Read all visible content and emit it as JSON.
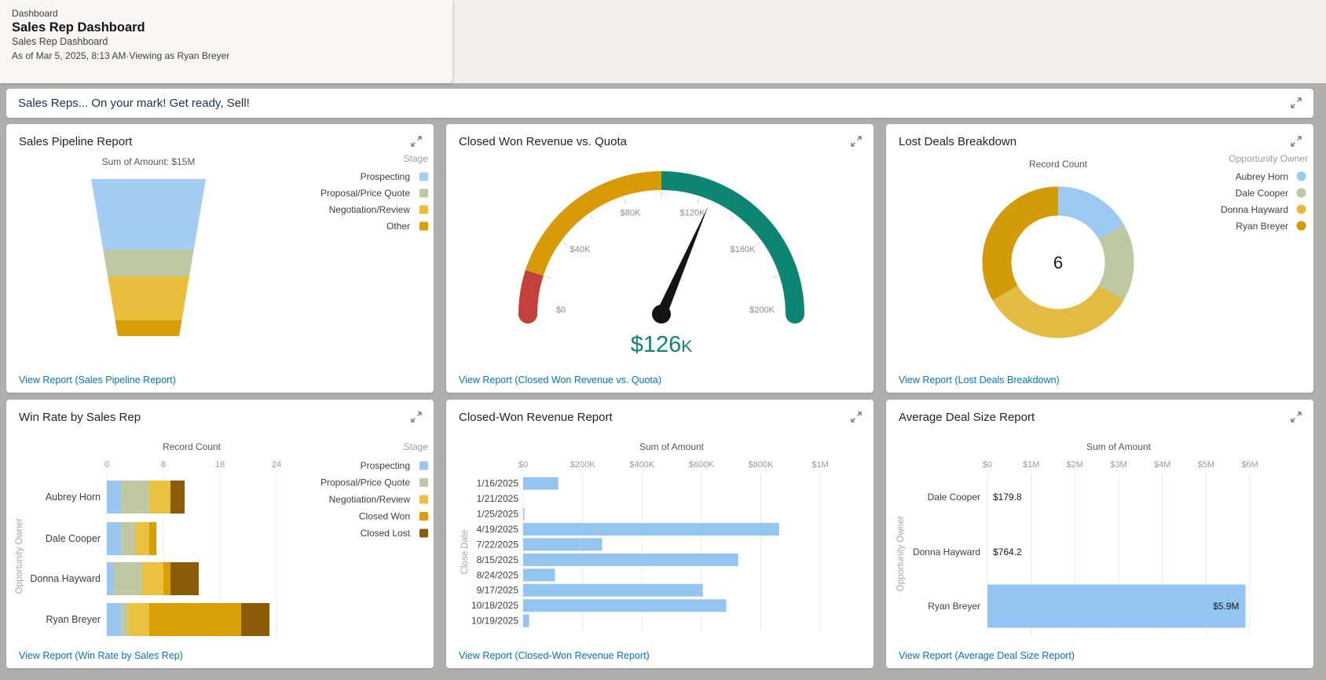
{
  "header": {
    "breadcrumb": "Dashboard",
    "title": "Sales Rep Dashboard",
    "subtitle": "Sales Rep Dashboard",
    "as_of": "As of Mar 5, 2025, 8:13 AM·Viewing as Ryan Breyer"
  },
  "banner": {
    "message": "Sales Reps... On your mark! Get ready, Sell!"
  },
  "colors": {
    "link": "#0176d3",
    "banner_text": "#16325c",
    "prospecting": "#9ac6f0",
    "proposal": "#bfc8a3",
    "negotiation": "#ebc23f",
    "closed_won": "#d9a006",
    "closed_lost": "#8a5c08",
    "gauge_red": "#c3413a",
    "gauge_orange": "#d89b06",
    "gauge_teal": "#0c8572",
    "bar_blue": "#94c5f0"
  },
  "panels": [
    {
      "title": "Sales Pipeline Report",
      "link": "View Report (Sales Pipeline Report)"
    },
    {
      "title": "Closed Won Revenue vs. Quota",
      "link": "View Report (Closed Won Revenue vs. Quota)"
    },
    {
      "title": "Lost Deals Breakdown",
      "link": "View Report (Lost Deals Breakdown)"
    },
    {
      "title": "Win Rate by Sales Rep",
      "link": "View Report (Win Rate by Sales Rep)"
    },
    {
      "title": "Closed-Won Revenue Report",
      "link": "View Report (Closed-Won Revenue Report)"
    },
    {
      "title": "Average Deal Size Report",
      "link": "View Report (Average Deal Size Report)"
    }
  ],
  "chart_data": [
    {
      "type": "funnel",
      "panel": "Sales Pipeline Report",
      "title": "Sum of Amount: $15M",
      "legend_title": "Stage",
      "categories": [
        "Prospecting",
        "Proposal/Price Quote",
        "Negotiation/Review",
        "Other"
      ],
      "percents": [
        45,
        17,
        28,
        10
      ],
      "colors": [
        "#a3cdf3",
        "#bfc8a3",
        "#e9be3d",
        "#d89e07"
      ]
    },
    {
      "type": "gauge",
      "panel": "Closed Won Revenue vs. Quota",
      "min": 0,
      "max": 200000,
      "value": 126000,
      "display_value": "$126",
      "display_suffix": "K",
      "tick_labels": [
        "$0",
        "$40K",
        "$80K",
        "$120K",
        "$160K",
        "$200K"
      ],
      "bands": [
        {
          "from": 0,
          "to": 20000,
          "color": "#c3413a"
        },
        {
          "from": 20000,
          "to": 100000,
          "color": "#d89b06"
        },
        {
          "from": 100000,
          "to": 200000,
          "color": "#0c8572"
        }
      ],
      "value_color": "#0d8473"
    },
    {
      "type": "donut",
      "panel": "Lost Deals Breakdown",
      "title": "Record Count",
      "center_value": "6",
      "legend_title": "Opportunity Owner",
      "segments": [
        {
          "label": "Aubrey Horn",
          "value": 1,
          "color": "#9cc9f2"
        },
        {
          "label": "Dale Cooper",
          "value": 1,
          "color": "#bec7a1"
        },
        {
          "label": "Donna Hayward",
          "value": 2,
          "color": "#e3bb42"
        },
        {
          "label": "Ryan Breyer",
          "value": 2,
          "color": "#d49b08"
        }
      ]
    },
    {
      "type": "stacked_bar",
      "panel": "Win Rate by Sales Rep",
      "title": "Record Count",
      "ylabel": "Opportunity Owner",
      "legend_title": "Stage",
      "x_ticks": [
        0,
        8,
        16,
        24
      ],
      "x_max": 24,
      "categories": [
        "Aubrey Horn",
        "Dale Cooper",
        "Donna Hayward",
        "Ryan Breyer"
      ],
      "series": [
        {
          "name": "Prospecting",
          "color": "#9ac6f0",
          "values": [
            2,
            2,
            1,
            2
          ]
        },
        {
          "name": "Proposal/Price Quote",
          "color": "#bfc8a3",
          "values": [
            4,
            2,
            4,
            1
          ]
        },
        {
          "name": "Negotiation/Review",
          "color": "#ebc23f",
          "values": [
            3,
            2,
            3,
            3
          ]
        },
        {
          "name": "Closed Won",
          "color": "#d9a006",
          "values": [
            0,
            1,
            1,
            13
          ]
        },
        {
          "name": "Closed Lost",
          "color": "#8a5c08",
          "values": [
            2,
            0,
            4,
            4
          ]
        }
      ]
    },
    {
      "type": "bar",
      "panel": "Closed-Won Revenue Report",
      "title": "Sum of Amount",
      "ylabel": "Close Date",
      "x_ticks": [
        "$0",
        "$200K",
        "$400K",
        "$600K",
        "$800K",
        "$1M"
      ],
      "x_max": 1000000,
      "bar_color": "#94c5f0",
      "categories": [
        "1/16/2025",
        "1/21/2025",
        "1/25/2025",
        "4/19/2025",
        "7/22/2025",
        "8/15/2025",
        "8/24/2025",
        "9/17/2025",
        "10/18/2025",
        "10/19/2025"
      ],
      "values": [
        118000,
        1000,
        4000,
        862000,
        266000,
        724000,
        107000,
        605000,
        684000,
        20000
      ]
    },
    {
      "type": "bar",
      "panel": "Average Deal Size Report",
      "title": "Sum of Amount",
      "ylabel": "Opportunity Owner",
      "x_ticks": [
        "$0",
        "$1M",
        "$2M",
        "$3M",
        "$4M",
        "$5M",
        "$6M"
      ],
      "x_max": 6000000,
      "bar_color": "#94c5f0",
      "categories": [
        "Dale Cooper",
        "Donna Hayward",
        "Ryan Breyer"
      ],
      "values": [
        179.8,
        764.2,
        5900000
      ],
      "value_labels": [
        "$179.8",
        "$764.2",
        "$5.9M"
      ]
    }
  ]
}
